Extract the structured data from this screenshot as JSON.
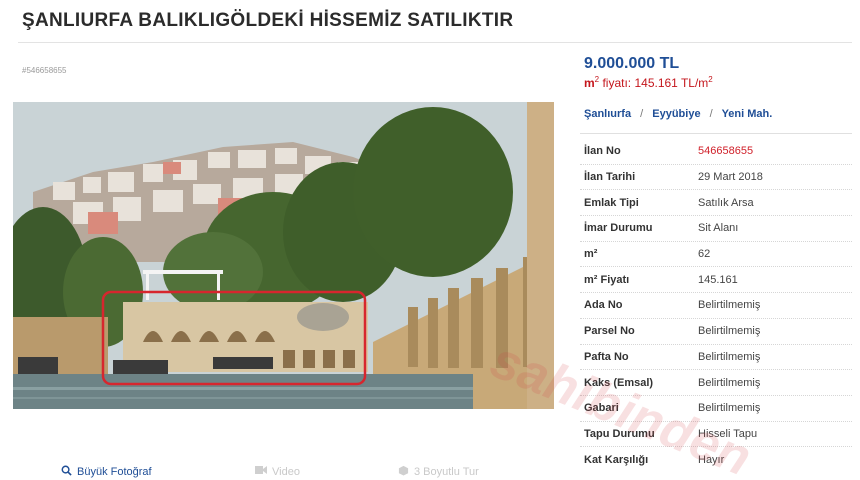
{
  "listing": {
    "title": "ŞANLIURFA BALIKLIGÖLDEKİ HİSSEMİZ SATILIKTIR",
    "code": "#546658655"
  },
  "price": {
    "amount": "9.000.000 TL",
    "m2_label": "m",
    "m2_sup": "2",
    "m2_text": " fiyatı: 145.161 TL/m",
    "m2_unit_sup": "2"
  },
  "location": {
    "city": "Şanlıurfa",
    "district": "Eyyübiye",
    "neighborhood": "Yeni Mah.",
    "separator": "/"
  },
  "details": [
    {
      "key": "İlan No",
      "value": "546658655",
      "highlight": true
    },
    {
      "key": "İlan Tarihi",
      "value": "29 Mart 2018"
    },
    {
      "key": "Emlak Tipi",
      "value": "Satılık Arsa"
    },
    {
      "key": "İmar Durumu",
      "value": "Sit Alanı"
    },
    {
      "key": "m²",
      "value": "62"
    },
    {
      "key": "m² Fiyatı",
      "value": "145.161"
    },
    {
      "key": "Ada No",
      "value": "Belirtilmemiş"
    },
    {
      "key": "Parsel No",
      "value": "Belirtilmemiş"
    },
    {
      "key": "Pafta No",
      "value": "Belirtilmemiş"
    },
    {
      "key": "Kaks (Emsal)",
      "value": "Belirtilmemiş"
    },
    {
      "key": "Gabari",
      "value": "Belirtilmemiş"
    },
    {
      "key": "Tapu Durumu",
      "value": "Hisseli Tapu"
    },
    {
      "key": "Kat Karşılığı",
      "value": "Hayır"
    }
  ],
  "photo_actions": {
    "big_photo": "Büyük Fotoğraf",
    "video": "Video",
    "street_view": "3 Boyutlu Tur"
  },
  "watermark": "sahibinden",
  "colors": {
    "link_blue": "#1f4e96",
    "accent_red": "#c4161c",
    "highlight_box": "#d7262e"
  }
}
